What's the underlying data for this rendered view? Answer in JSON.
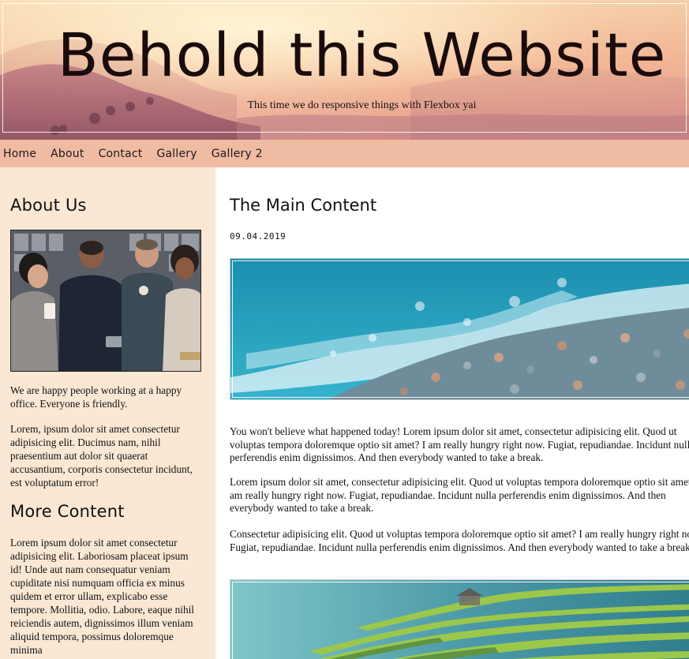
{
  "header": {
    "title": "Behold this Website",
    "subtitle": "This time we do responsive things with Flexbox yai"
  },
  "nav": {
    "items": [
      "Home",
      "About",
      "Contact",
      "Gallery",
      "Gallery 2"
    ]
  },
  "sidebar": {
    "about_title": "About Us",
    "about_text_1": "We are happy people working at a happy office. Everyone is friendly.",
    "about_text_2": "Lorem, ipsum dolor sit amet consectetur adipisicing elit. Ducimus nam, nihil praesentium aut dolor sit quaerat accusantium, corporis consectetur incidunt, est voluptatum error!",
    "more_title": "More Content",
    "more_text": "Lorem ipsum dolor sit amet consectetur adipisicing elit. Laboriosam placeat ipsum id! Unde aut nam consequatur veniam cupiditate nisi numquam officia ex minus quidem et error ullam, explicabo esse tempore. Mollitia, odio. Labore, eaque nihil reiciendis autem, dignissimos illum veniam aliquid tempora, possimus doloremque minima"
  },
  "main": {
    "title": "The Main Content",
    "date": "09.04.2019",
    "paragraphs": [
      "You won't believe what happened today! Lorem ipsum dolor sit amet, consectetur adipisicing elit. Quod ut voluptas tempora doloremque optio sit amet? I am really hungry right now. Fugiat, repudiandae. Incidunt nulla perferendis enim dignissimos. And then everybody wanted to take a break.",
      "Lorem ipsum dolor sit amet, consectetur adipisicing elit. Quod ut voluptas tempora doloremque optio sit amet? I am really hungry right now. Fugiat, repudiandae. Incidunt nulla perferendis enim dignissimos. And then everybody wanted to take a break.",
      "Consectetur adipisicing elit. Quod ut voluptas tempora doloremque optio sit amet? I am really hungry right now. Fugiat, repudiandae. Incidunt nulla perferendis enim dignissimos. And then everybody wanted to take a break."
    ]
  },
  "colors": {
    "nav_bg": "#f0bba3",
    "sidebar_bg": "#fae8d4",
    "title_color": "#1a0b0d"
  }
}
